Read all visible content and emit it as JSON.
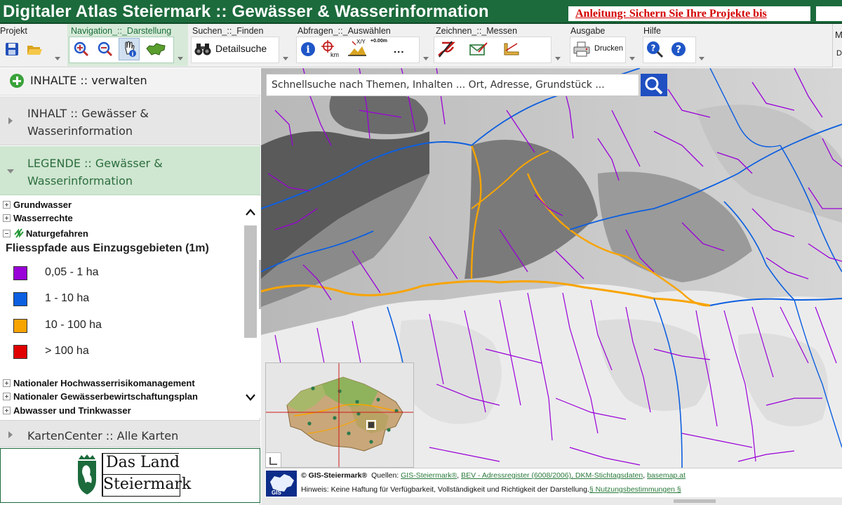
{
  "app": {
    "title": "Digitaler Atlas Steiermark :: Gewässer & Wasserinformation",
    "ticker": "Anleitung: Sichern Sie Ihre Projekte bis",
    "edge_top": "M",
    "edge_bottom": "D"
  },
  "toolbar": {
    "groups": [
      {
        "label": "Projekt"
      },
      {
        "label": "Navigation_::_Darstellung"
      },
      {
        "label": "Suchen_::_Finden"
      },
      {
        "label": "Abfragen_::_Auswählen"
      },
      {
        "label": "Zeichnen_::_Messen"
      },
      {
        "label": "Ausgabe"
      },
      {
        "label": "Hilfe"
      }
    ],
    "detail_search_label": "Detailsuche",
    "print_label": "Drucken",
    "measure_labels": {
      "km": "km",
      "xy": "X/Y",
      "height": "+0.00m"
    },
    "more_label": "..."
  },
  "sidebar": {
    "manage_label": "INHALTE :: verwalten",
    "inhalt_label": "INHALT :: Gewässer & Wasserinformation",
    "legende_label": "LEGENDE :: Gewässer & Wasserinformation",
    "karten_label": "KartenCenter :: Alle Karten",
    "tree_top": [
      "Grundwasser",
      "Wasserrechte",
      "Naturgefahren"
    ],
    "legend_title": "Fliesspfade aus Einzugsgebieten (1m)",
    "legend_items": [
      {
        "label": "0,05 - 1 ha",
        "color": "#9a00d8"
      },
      {
        "label": "1 - 10 ha",
        "color": "#0c5fe0"
      },
      {
        "label": "10 - 100 ha",
        "color": "#f8a400"
      },
      {
        "label": "> 100 ha",
        "color": "#e00000"
      }
    ],
    "tree_bottom": [
      "Nationaler Hochwasserrisikomanagement",
      "Nationaler Gewässerbewirtschaftungsplan",
      "Abwasser und Trinkwasser"
    ],
    "logo_line1": "Das Land",
    "logo_line2": "Steiermark"
  },
  "map": {
    "search_placeholder": "Schnellsuche nach Themen, Inhalten ... Ort, Adresse, Grundstück ...",
    "attribution": {
      "copyright": "© GIS-Steiermark®",
      "sources_label": "Quellen:",
      "sources": [
        "GIS-Steiermark®",
        "BEV - Adressregister (6008/2006), DKM-Stichtagsdaten",
        "basemap.at"
      ],
      "hint": "Hinweis: Keine Haftung für Verfügbarkeit, Vollständigkeit und Richtigkeit der Darstellung.",
      "terms_link": "§ Nutzungsbestimmungen §",
      "gis_logo_text": "GIS"
    }
  },
  "colors": {
    "brand_green": "#1c6b3c",
    "ticker_red": "#d40000",
    "search_blue": "#1f4fc1",
    "flow_purple": "#9a00d8",
    "flow_blue": "#0c5fe0",
    "flow_orange": "#f8a400"
  }
}
